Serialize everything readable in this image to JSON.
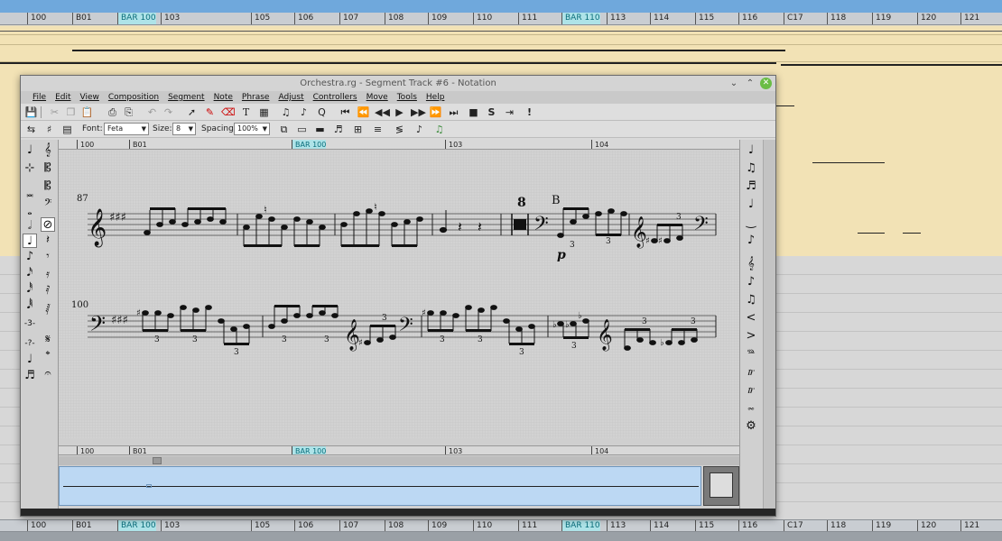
{
  "main_window": {
    "top_ruler": [
      {
        "label": "100",
        "marker": false
      },
      {
        "label": "B01",
        "marker": false
      },
      {
        "label": "BAR 100",
        "marker": true
      },
      {
        "label": "103",
        "marker": false
      },
      {
        "label": "105",
        "marker": false
      },
      {
        "label": "106",
        "marker": false
      },
      {
        "label": "107",
        "marker": false
      },
      {
        "label": "108",
        "marker": false
      },
      {
        "label": "109",
        "marker": false
      },
      {
        "label": "110",
        "marker": false
      },
      {
        "label": "111",
        "marker": false
      },
      {
        "label": "BAR 110",
        "marker": true
      },
      {
        "label": "113",
        "marker": false
      },
      {
        "label": "114",
        "marker": false
      },
      {
        "label": "115",
        "marker": false
      },
      {
        "label": "116",
        "marker": false
      },
      {
        "label": "C17",
        "marker": false
      },
      {
        "label": "118",
        "marker": false
      },
      {
        "label": "119",
        "marker": false
      },
      {
        "label": "120",
        "marker": false
      },
      {
        "label": "121",
        "marker": false
      }
    ]
  },
  "window": {
    "title": "Orchestra.rg - Segment Track #6 - Notation",
    "minimize": "⌄",
    "maximize": "⌃",
    "close": "✕"
  },
  "menu": [
    "File",
    "Edit",
    "View",
    "Composition",
    "Segment",
    "Note",
    "Phrase",
    "Adjust",
    "Controllers",
    "Move",
    "Tools",
    "Help"
  ],
  "toolbar": {
    "font_label": "Font:",
    "font_value": "Feta",
    "size_label": "Size:",
    "size_value": "8",
    "spacing_label": "Spacing:",
    "spacing_value": "100%"
  },
  "score_ruler": [
    {
      "label": "100",
      "marker": false
    },
    {
      "label": "B01",
      "marker": false
    },
    {
      "label": "BAR 100",
      "marker": true
    },
    {
      "label": "103",
      "marker": false
    },
    {
      "label": "104",
      "marker": false
    }
  ],
  "score": {
    "system1_bar_number": "87",
    "system2_bar_number": "100",
    "multirest_count": "8",
    "rehearsal_mark": "B",
    "dynamic": "p",
    "tuplet": "3"
  }
}
